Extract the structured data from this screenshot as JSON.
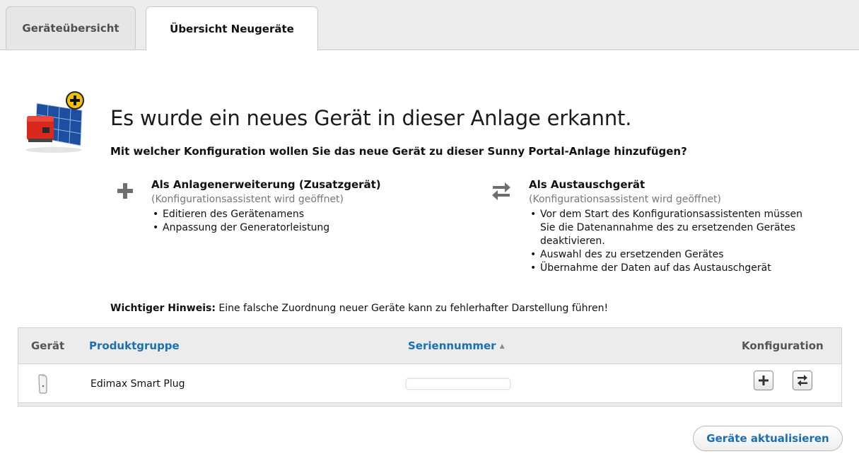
{
  "tabs": [
    {
      "label": "Geräteübersicht",
      "active": false
    },
    {
      "label": "Übersicht Neugeräte",
      "active": true
    }
  ],
  "heading": {
    "title": "Es wurde ein neues Gerät in dieser Anlage erkannt.",
    "subtitle": "Mit welcher Konfiguration wollen Sie das neue Gerät zu dieser Sunny Portal-Anlage hinzufügen?",
    "icon": "solar-device-add-icon"
  },
  "options": {
    "extension": {
      "icon": "plus-icon",
      "title": "Als Anlagenerweiterung (Zusatzgerät)",
      "note": "(Konfigurationsassistent wird geöffnet)",
      "items": [
        "Editieren des Gerätenamens",
        "Anpassung der Generatorleistung"
      ]
    },
    "replacement": {
      "icon": "swap-arrows-icon",
      "title": "Als Austauschgerät",
      "note": "(Konfigurationsassistent wird geöffnet)",
      "items": [
        "Vor dem Start des Konfigurationsassistenten müssen",
        "Sie die Datenannahme des zu ersetzenden Gerätes",
        "deaktivieren.",
        "Auswahl des zu ersetzenden Gerätes",
        "Übernahme der Daten auf das Austauschgerät"
      ]
    }
  },
  "hint": {
    "label": "Wichtiger Hinweis:",
    "text": " Eine falsche Zuordnung neuer Geräte kann zu fehlerhafter Darstellung führen!"
  },
  "table": {
    "headers": {
      "device": "Gerät",
      "product_group": "Produktgruppe",
      "serial": "Seriennummer",
      "sort_indicator": "▲",
      "configuration": "Konfiguration"
    },
    "rows": [
      {
        "device_icon": "smart-plug-icon",
        "product_group": "Edimax Smart Plug",
        "serial": ""
      }
    ]
  },
  "actions": {
    "refresh_label": "Geräte aktualisieren"
  },
  "colors": {
    "link": "#1b6fb5",
    "tab_bar": "#ececec"
  }
}
